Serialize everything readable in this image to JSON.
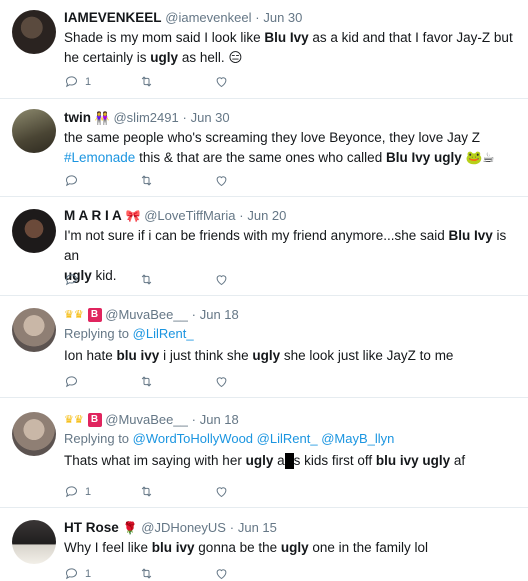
{
  "tweets": [
    {
      "name": "IAMEVENKEEL",
      "handle": "@iamevenkeel",
      "dot": "·",
      "time": "Jun 30",
      "line1_a": "Shade is my mom said I look like ",
      "line1_b": "Blu Ivy",
      "line1_c": " as a kid and that I favor Jay-Z but",
      "line2_a": "he certainly is ",
      "line2_b": "ugly",
      "line2_c": " as hell. ",
      "emoji_end": "😑",
      "reply_count": "1",
      "retweet_count": "",
      "like_count": ""
    },
    {
      "name": "twin",
      "name_emoji": "👭",
      "handle": "@slim2491",
      "dot": "·",
      "time": "Jun 30",
      "line1": "the same people who's screaming they love Beyonce, they love Jay Z",
      "hashtag": "#Lemonade",
      "line2_a": " this & that are the same ones who called ",
      "line2_b": "Blu Ivy ugly",
      "emoji_end": "🐸☕",
      "reply_count": "",
      "retweet_count": "",
      "like_count": ""
    },
    {
      "name": "M A R I A",
      "name_emoji": "🎀",
      "handle": "@LoveTiffMaria",
      "dot": "·",
      "time": "Jun 20",
      "line1_a": "I'm not sure if i can be friends with my friend anymore...she said ",
      "line1_b": "Blu Ivy",
      "line1_c": " is an",
      "line2_a": "ugly",
      "line2_b": " kid.",
      "reply_count": "",
      "retweet_count": "",
      "like_count": ""
    },
    {
      "name_badge": "B",
      "handle": "@MuvaBee__",
      "dot": "·",
      "time": "Jun 18",
      "replying_label": "Replying to ",
      "replying_to": "@LilRent_",
      "line1_a": "Ion hate ",
      "line1_b": "blu ivy",
      "line1_c": " i just think she ",
      "line1_d": "ugly",
      "line1_e": " she look just like JayZ to me",
      "reply_count": "",
      "retweet_count": "",
      "like_count": ""
    },
    {
      "name_badge": "B",
      "handle": "@MuvaBee__",
      "dot": "·",
      "time": "Jun 18",
      "replying_label": "Replying to ",
      "replying_to_1": "@WordToHollyWood",
      "replying_to_2": "@LilRent_",
      "replying_to_3": "@MayB_llyn",
      "line1_a": "Thats what im saying with her ",
      "line1_b": "ugly",
      "line1_c": " a",
      "line1_d": "s kids first off ",
      "line1_e": "blu ivy ugly",
      "line1_f": " af",
      "reply_count": "1",
      "retweet_count": "",
      "like_count": ""
    },
    {
      "name": "HT Rose",
      "name_emoji": "🌹",
      "handle": "@JDHoneyUS",
      "dot": "·",
      "time": "Jun 15",
      "line1_a": "Why I feel like ",
      "line1_b": "blu ivy",
      "line1_c": " gonna be the ",
      "line1_d": "ugly",
      "line1_e": " one in the family lol",
      "reply_count": "1",
      "retweet_count": "",
      "like_count": ""
    }
  ],
  "icons": {
    "reply": "reply-icon",
    "retweet": "retweet-icon",
    "like": "heart-icon",
    "crown": "crown-icon"
  },
  "colors": {
    "link": "#1b95e0",
    "muted": "#657786",
    "divider": "#e6ecf0",
    "badge": "#e0245e"
  }
}
